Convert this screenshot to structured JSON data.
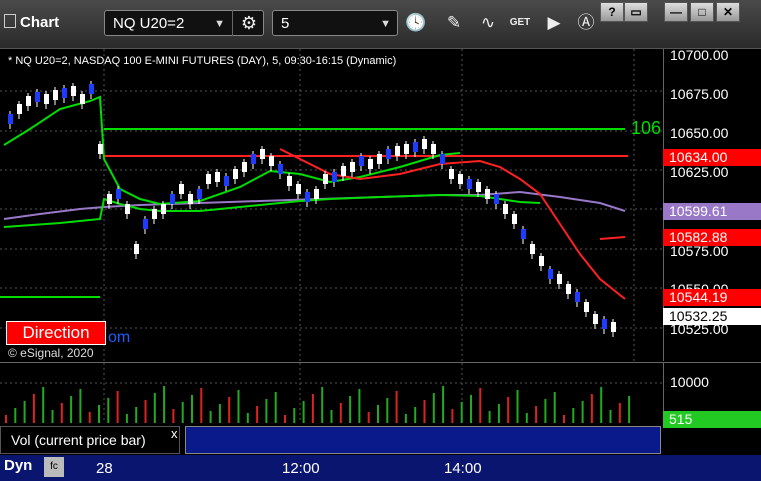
{
  "toolbar": {
    "app_title": "Chart",
    "symbol": "NQ U20=2",
    "interval": "5",
    "window_buttons": [
      "?",
      "▭",
      "—",
      "□",
      "✕"
    ]
  },
  "chart": {
    "info": "* NQ U20=2, NASDAQ 100 E-MINI FUTURES (DAY), 5, 09:30-16:15 (Dynamic)",
    "green_line_label": "106",
    "direction_label": "Direction",
    "om_text": "om",
    "copyright": "© eSignal, 2020",
    "price_ticks": [
      "10700.00",
      "10675.00",
      "10650.00",
      "10625.00",
      "10575.00",
      "10550.00",
      "10525.00"
    ],
    "price_tags": [
      {
        "text": "10634.00",
        "bg": "#ff0000",
        "fg": "#ffffff"
      },
      {
        "text": "10599.61",
        "bg": "#9a78c8",
        "fg": "#ffffff"
      },
      {
        "text": "10582.88",
        "bg": "#ff0000",
        "fg": "#ffffff"
      },
      {
        "text": "10544.19",
        "bg": "#ff0000",
        "fg": "#ffffff"
      },
      {
        "text": "10532.25",
        "bg": "#ffffff",
        "fg": "#000000"
      }
    ]
  },
  "volume": {
    "label": "Vol (current price bar)",
    "close": "x",
    "tick": "10000",
    "current": "515"
  },
  "status": {
    "mode": "Dyn",
    "time_labels": [
      "28",
      "12:00",
      "14:00"
    ]
  }
}
